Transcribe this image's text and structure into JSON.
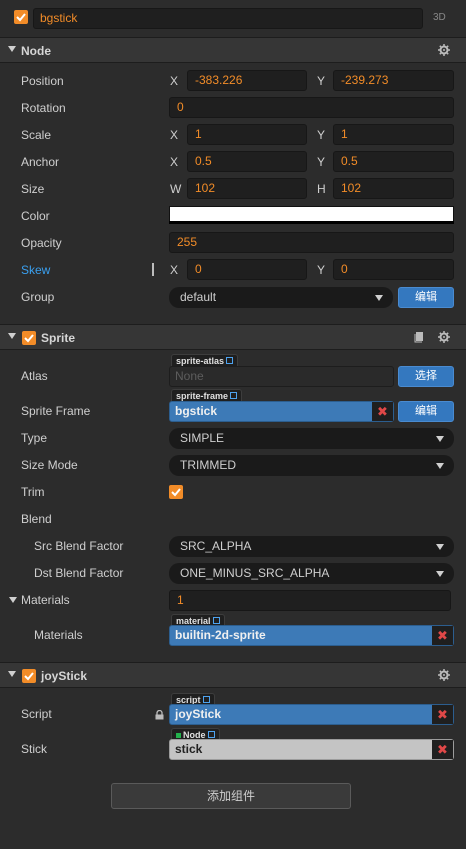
{
  "node": {
    "name": "bgstick",
    "mode_3d": "3D"
  },
  "node_section": {
    "title": "Node",
    "position": {
      "label": "Position",
      "x_axis": "X",
      "x": "-383.226",
      "y_axis": "Y",
      "y": "-239.273"
    },
    "rotation": {
      "label": "Rotation",
      "value": "0"
    },
    "scale": {
      "label": "Scale",
      "x_axis": "X",
      "x": "1",
      "y_axis": "Y",
      "y": "1"
    },
    "anchor": {
      "label": "Anchor",
      "x_axis": "X",
      "x": "0.5",
      "y_axis": "Y",
      "y": "0.5"
    },
    "size": {
      "label": "Size",
      "w_axis": "W",
      "w": "102",
      "h_axis": "H",
      "h": "102"
    },
    "color": {
      "label": "Color",
      "value": "#ffffff"
    },
    "opacity": {
      "label": "Opacity",
      "value": "255"
    },
    "skew": {
      "label": "Skew",
      "x_axis": "X",
      "x": "0",
      "y_axis": "Y",
      "y": "0"
    },
    "group": {
      "label": "Group",
      "value": "default",
      "edit_button": "编辑"
    }
  },
  "sprite_section": {
    "title": "Sprite",
    "atlas": {
      "label": "Atlas",
      "tag": "sprite-atlas",
      "placeholder": "None",
      "button": "选择"
    },
    "sprite_frame": {
      "label": "Sprite Frame",
      "tag": "sprite-frame",
      "value": "bgstick",
      "button": "编辑"
    },
    "type": {
      "label": "Type",
      "value": "SIMPLE"
    },
    "size_mode": {
      "label": "Size Mode",
      "value": "TRIMMED"
    },
    "trim": {
      "label": "Trim",
      "checked": true
    },
    "blend": {
      "label": "Blend"
    },
    "src_blend": {
      "label": "Src Blend Factor",
      "value": "SRC_ALPHA"
    },
    "dst_blend": {
      "label": "Dst Blend Factor",
      "value": "ONE_MINUS_SRC_ALPHA"
    },
    "materials_group": {
      "label": "Materials",
      "count": "1"
    },
    "materials_item": {
      "label": "Materials",
      "tag": "material",
      "value": "builtin-2d-sprite"
    }
  },
  "joystick_section": {
    "title": "joyStick",
    "script": {
      "label": "Script",
      "tag": "script",
      "value": "joyStick"
    },
    "stick": {
      "label": "Stick",
      "tag": "Node",
      "value": "stick"
    }
  },
  "add_component": "添加组件",
  "colors": {
    "accent": "#f28c28",
    "asset_blue": "#3d7ab7",
    "button_blue": "#3478bf",
    "skew_label": "#3aa0f0",
    "remove_red": "#e04848"
  }
}
